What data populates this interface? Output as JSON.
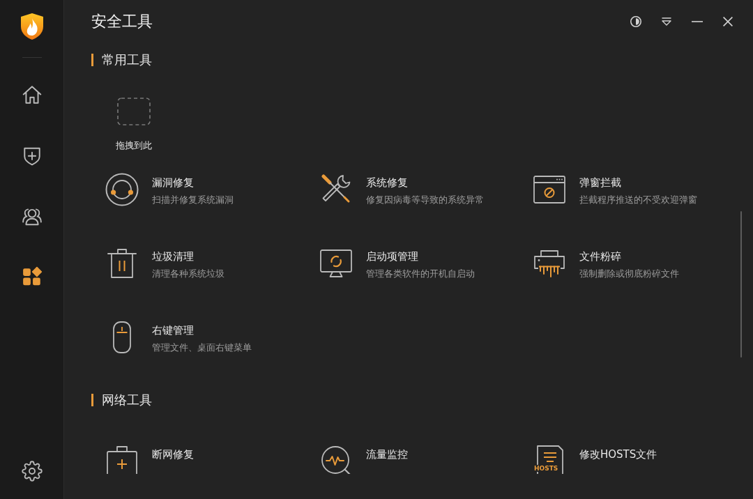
{
  "window": {
    "title": "安全工具"
  },
  "sidebar": {
    "items": [
      {
        "kind": "home",
        "selected": false
      },
      {
        "kind": "protection",
        "selected": false
      },
      {
        "kind": "accounts",
        "selected": false
      },
      {
        "kind": "tools",
        "selected": true
      }
    ]
  },
  "sections": [
    {
      "title": "常用工具",
      "drop_zone": {
        "label": "拖拽到此"
      },
      "tools": [
        {
          "kind": "vulnerability",
          "title": "漏洞修复",
          "description": "扫描并修复系统漏洞"
        },
        {
          "kind": "repair",
          "title": "系统修复",
          "description": "修复因病毒等导致的系统异常"
        },
        {
          "kind": "popup",
          "title": "弹窗拦截",
          "description": "拦截程序推送的不受欢迎弹窗"
        },
        {
          "kind": "cleanup",
          "title": "垃圾清理",
          "description": "清理各种系统垃圾"
        },
        {
          "kind": "startup",
          "title": "启动项管理",
          "description": "管理各类软件的开机自启动"
        },
        {
          "kind": "shredder",
          "title": "文件粉碎",
          "description": "强制删除或彻底粉碎文件"
        },
        {
          "kind": "contextmenu",
          "title": "右键管理",
          "description": "管理文件、桌面右键菜单"
        }
      ]
    },
    {
      "title": "网络工具",
      "tools": [
        {
          "kind": "netrepair",
          "title": "断网修复"
        },
        {
          "kind": "traffic",
          "title": "流量监控"
        },
        {
          "kind": "hosts",
          "title": "修改HOSTS文件",
          "icon_label": "HOSTS"
        }
      ]
    }
  ]
}
